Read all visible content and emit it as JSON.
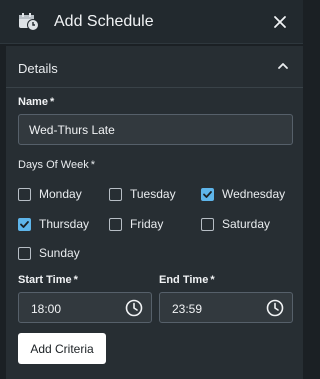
{
  "header": {
    "title": "Add Schedule",
    "icon": "calendar-clock-icon",
    "close_icon": "close-icon"
  },
  "section": {
    "label": "Details",
    "expanded": true,
    "icon": "chevron-up-icon"
  },
  "name_field": {
    "label": "Name",
    "required_mark": "*",
    "value": "Wed-Thurs Late"
  },
  "days": {
    "label": "Days Of Week",
    "required_mark": "*",
    "items": [
      {
        "label": "Monday",
        "checked": false
      },
      {
        "label": "Tuesday",
        "checked": false
      },
      {
        "label": "Wednesday",
        "checked": true
      },
      {
        "label": "Thursday",
        "checked": true
      },
      {
        "label": "Friday",
        "checked": false
      },
      {
        "label": "Saturday",
        "checked": false
      },
      {
        "label": "Sunday",
        "checked": false
      }
    ]
  },
  "start_time": {
    "label": "Start Time",
    "required_mark": "*",
    "value": "18:00"
  },
  "end_time": {
    "label": "End Time",
    "required_mark": "*",
    "value": "23:59"
  },
  "add_criteria_label": "Add Criteria",
  "colors": {
    "checkbox_checked": "#5eb5ea",
    "background": "#1b2024",
    "panel": "#272e33"
  }
}
